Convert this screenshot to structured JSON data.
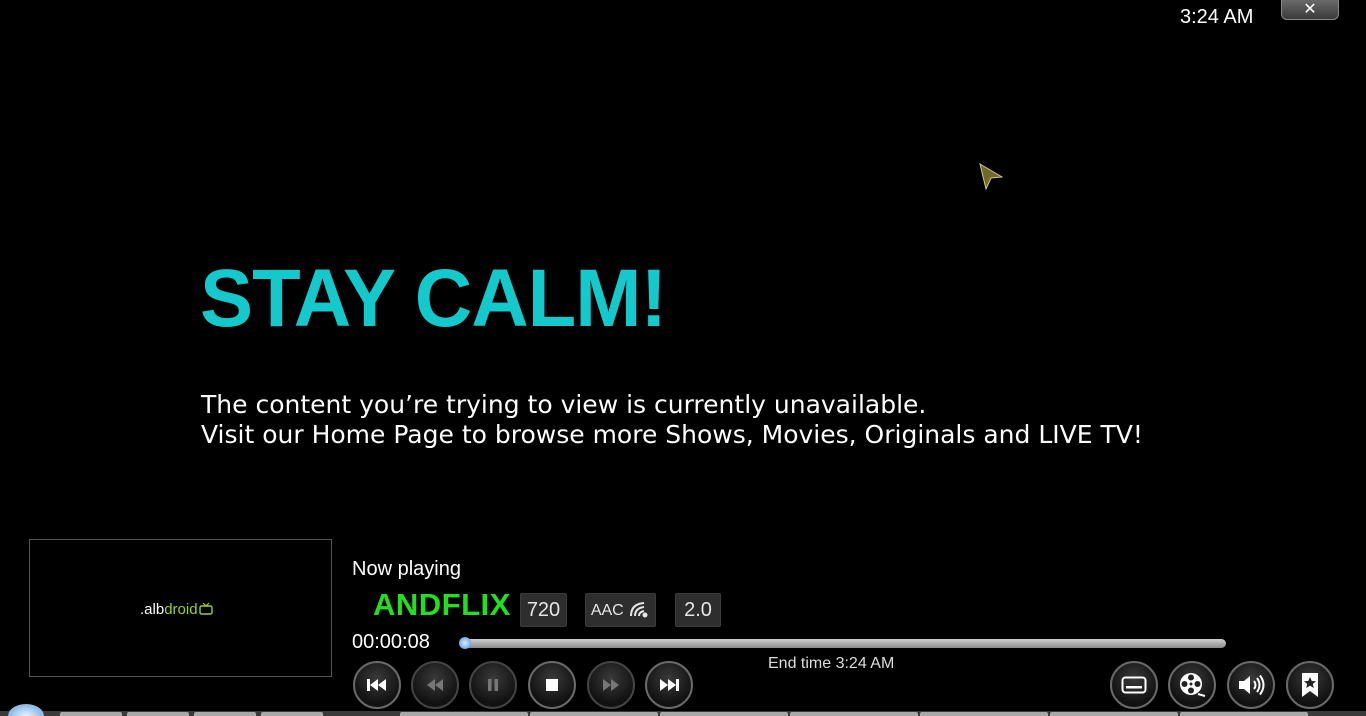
{
  "top_bar": {
    "clock": "3:24 AM",
    "close_label": "✕"
  },
  "message": {
    "headline": "STAY CALM!",
    "line1": "The content you’re trying to view is currently unavailable.",
    "line2": "Visit our Home Page to browse more Shows, Movies, Originals and LIVE TV!"
  },
  "thumbnail": {
    "logo_prefix": ".alb",
    "logo_suffix": "droid"
  },
  "player": {
    "now_playing_label": "Now playing",
    "title": "ANDFLIX",
    "resolution": "720",
    "audio_codec": "AAC",
    "channels": "2.0",
    "elapsed": "00:00:08",
    "end_time": "End time 3:24 AM",
    "progress_fraction": 0.006
  },
  "controls": [
    {
      "name": "skip-previous-button",
      "icon": "skip-previous-icon"
    },
    {
      "name": "rewind-button",
      "icon": "rewind-icon"
    },
    {
      "name": "pause-button",
      "icon": "pause-icon"
    },
    {
      "name": "stop-button",
      "icon": "stop-icon"
    },
    {
      "name": "fast-forward-button",
      "icon": "fast-forward-icon"
    },
    {
      "name": "skip-next-button",
      "icon": "skip-next-icon"
    },
    {
      "name": "subtitles-button",
      "icon": "subtitles-icon"
    },
    {
      "name": "video-settings-button",
      "icon": "film-reel-icon"
    },
    {
      "name": "audio-settings-button",
      "icon": "speaker-icon"
    },
    {
      "name": "bookmark-button",
      "icon": "bookmark-icon"
    }
  ],
  "colors": {
    "headline": "#13c9cc",
    "title": "#22e01e",
    "logo_accent": "#9fd027"
  }
}
